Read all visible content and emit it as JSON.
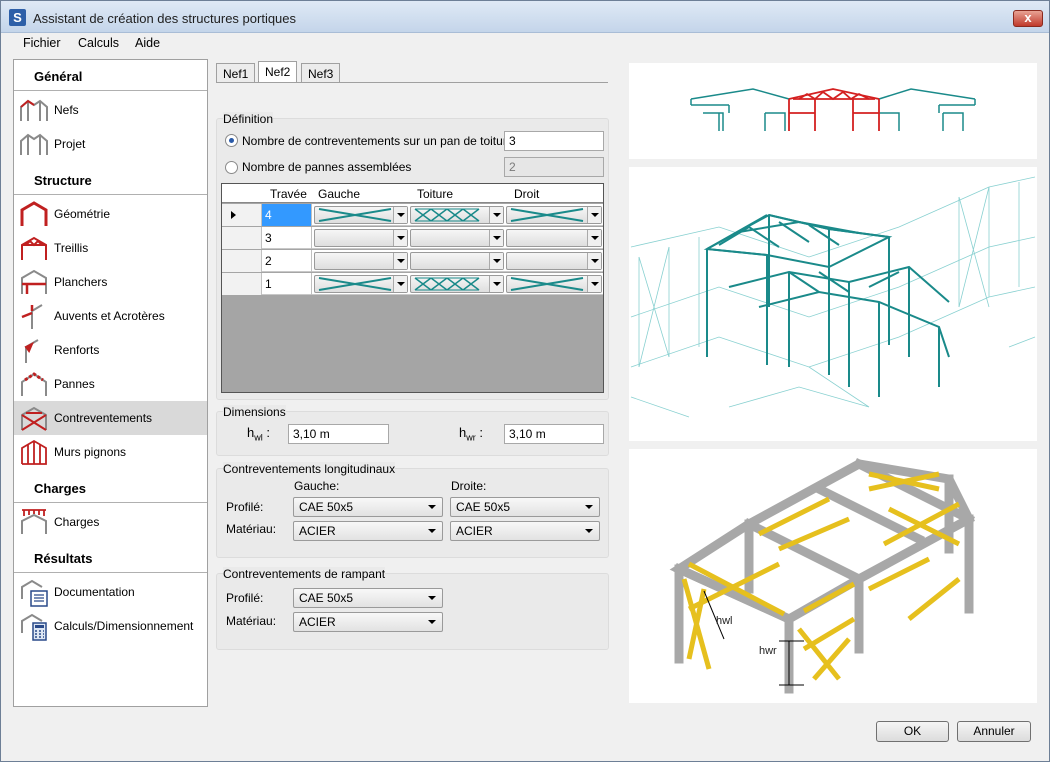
{
  "window": {
    "title": "Assistant de création des structures portiques",
    "icon_letter": "S",
    "close_symbol": "x"
  },
  "menu": [
    "Fichier",
    "Calculs",
    "Aide"
  ],
  "sidebar": {
    "sections": [
      {
        "title": "Général",
        "items": [
          "Nefs",
          "Projet"
        ]
      },
      {
        "title": "Structure",
        "items": [
          "Géométrie",
          "Treillis",
          "Planchers",
          "Auvents et Acrotères",
          "Renforts",
          "Pannes",
          "Contreventements",
          "Murs pignons"
        ]
      },
      {
        "title": "Charges",
        "items": [
          "Charges"
        ]
      },
      {
        "title": "Résultats",
        "items": [
          "Documentation",
          "Calculs/Dimensionnement"
        ]
      }
    ],
    "active_item": "Contreventements"
  },
  "tabs": [
    "Nef1",
    "Nef2",
    "Nef3"
  ],
  "active_tab": "Nef2",
  "definition": {
    "title": "Définition",
    "option1_label": "Nombre de contreventements sur un pan de toiture",
    "option1_value": "3",
    "option2_label": "Nombre de pannes assemblées",
    "option2_value": "2"
  },
  "grid": {
    "headers": [
      "Travée",
      "Gauche",
      "Toiture",
      "Droit"
    ],
    "rows": [
      "4",
      "3",
      "2",
      "1"
    ]
  },
  "dimensions": {
    "title": "Dimensions",
    "hwl_label": "h",
    "hwl_sub": "wl",
    "hwl_value": "3,10 m",
    "hwr_label": "h",
    "hwr_sub": "wr",
    "hwr_value": "3,10 m",
    "colon": ":"
  },
  "longitudinal": {
    "title": "Contreventements longitudinaux",
    "left_header": "Gauche:",
    "right_header": "Droite:",
    "profile_label": "Profilé:",
    "material_label": "Matériau:",
    "left_profile": "CAE 50x5",
    "right_profile": "CAE 50x5",
    "left_material": "ACIER",
    "right_material": "ACIER"
  },
  "rampant": {
    "title": "Contreventements de rampant",
    "profile_label": "Profilé:",
    "material_label": "Matériau:",
    "profile": "CAE 50x5",
    "material": "ACIER"
  },
  "preview_labels": {
    "hwl": "hwl",
    "hwr": "hwr"
  },
  "buttons": {
    "ok": "OK",
    "cancel": "Annuler"
  },
  "colors": {
    "frame": "#1a8a8a",
    "highlight": "#d42020",
    "brace": "#e6c01e",
    "steel": "#b8b8b8"
  }
}
